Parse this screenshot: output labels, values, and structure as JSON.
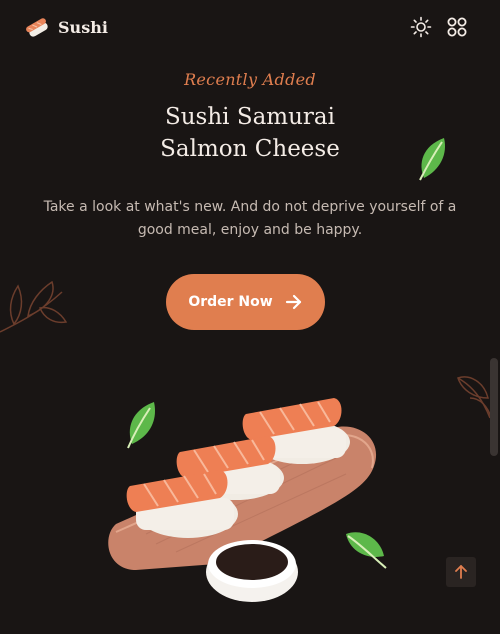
{
  "header": {
    "brand": "Sushi",
    "icons": {
      "logo": "sushi-icon",
      "theme": "sun-icon",
      "menu": "grid-icon"
    }
  },
  "hero": {
    "subtitle": "Recently Added",
    "title_line1": "Sushi Samurai",
    "title_line2": "Salmon Cheese",
    "description": "Take a look at what's new. And do not deprive yourself of a good meal, enjoy and be happy.",
    "cta_label": "Order Now",
    "cta_icon": "arrow-right-icon"
  },
  "scroll_top": {
    "icon": "arrow-up-icon"
  },
  "colors": {
    "background": "#191514",
    "accent": "#e07e4f",
    "text": "#f4ece6",
    "muted_text": "#c6bab2"
  }
}
